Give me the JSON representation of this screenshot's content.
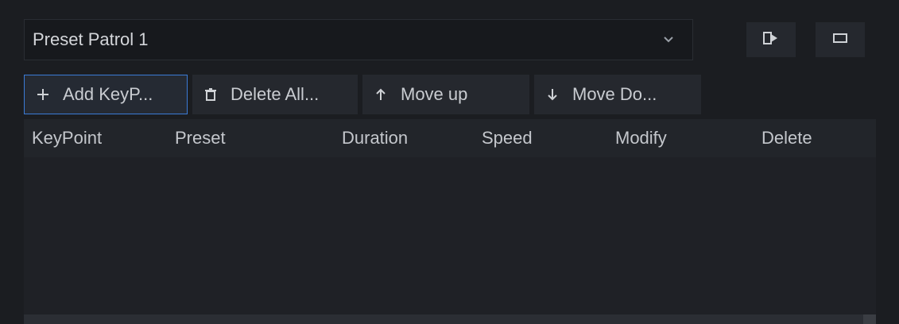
{
  "patrol_select": {
    "value": "Preset Patrol 1",
    "chevron_icon": "chevron-down-icon"
  },
  "controls": {
    "play_icon": "play-patrol-icon",
    "stop_icon": "stop-patrol-icon"
  },
  "toolbar": {
    "add_label": "Add KeyP...",
    "delete_all_label": "Delete All...",
    "move_up_label": "Move up",
    "move_down_label": "Move Do..."
  },
  "table": {
    "columns": [
      "KeyPoint",
      "Preset",
      "Duration",
      "Speed",
      "Modify",
      "Delete"
    ],
    "rows": []
  },
  "colors": {
    "accent": "#3b7bd6",
    "background": "#1b1d21",
    "panel": "#25282e"
  }
}
